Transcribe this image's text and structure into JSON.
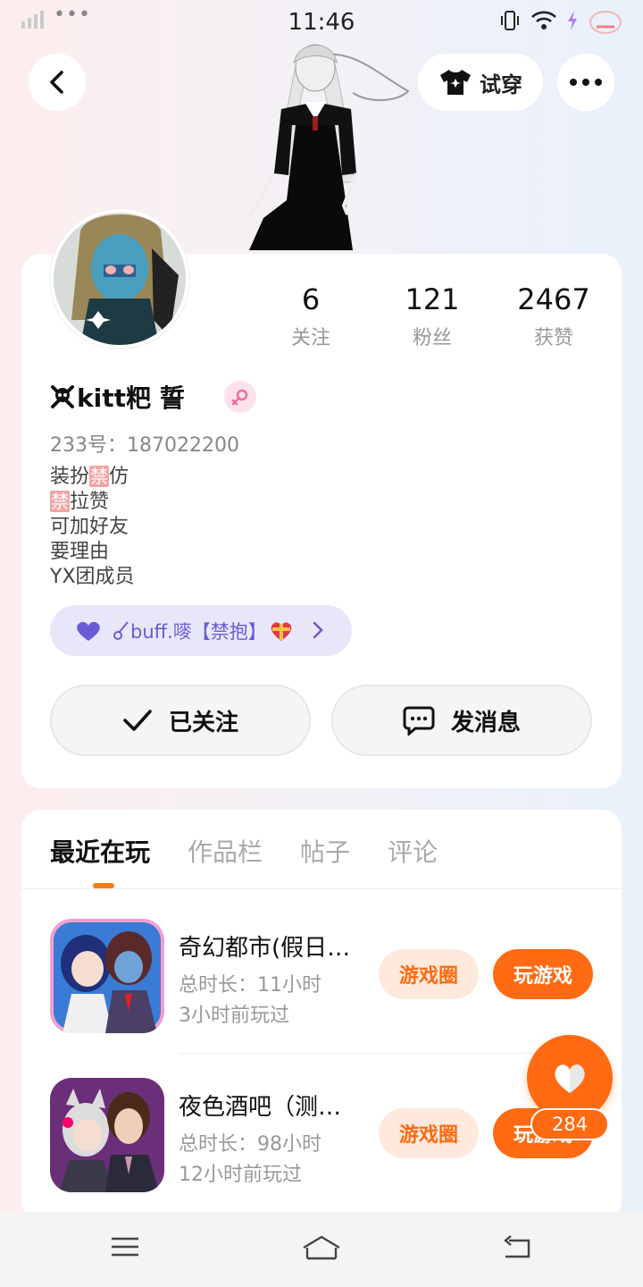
{
  "status_bar": {
    "time": "11:46",
    "dots": "•••"
  },
  "header": {
    "try_on_label": "试穿"
  },
  "stats": [
    {
      "value": "6",
      "label": "关注"
    },
    {
      "value": "121",
      "label": "粉丝"
    },
    {
      "value": "2467",
      "label": "获赞"
    }
  ],
  "profile": {
    "name": "kitt粑 誓",
    "uid": "233号：187022200",
    "bio": {
      "line1_pre": "装扮",
      "line1_ban": "禁",
      "line1_post": "仿",
      "line2_ban": "禁",
      "line2_post": "拉赞",
      "line3": "可加好友",
      "line4": "要理由",
      "line5": "YX团成员"
    },
    "buff_label": "buff.嘜【禁抱】"
  },
  "actions": {
    "follow_label": "已关注",
    "message_label": "发消息"
  },
  "tabs": [
    "最近在玩",
    "作品栏",
    "帖子",
    "评论"
  ],
  "games": [
    {
      "title": "奇幻都市(假日…",
      "duration": "总时长：11小时",
      "last_played": "3小时前玩过",
      "circle_label": "游戏圈",
      "play_label": "玩游戏"
    },
    {
      "title": "夜色酒吧（测…",
      "duration": "总时长：98小时",
      "last_played": "12小时前玩过",
      "circle_label": "游戏圈",
      "play_label": "玩游戏"
    }
  ],
  "fab": {
    "count": "284"
  },
  "colors": {
    "accent": "#ff6a12",
    "purple": "#6a5bd6"
  },
  "icons": [
    "back-icon",
    "tshirt-icon",
    "more-icon",
    "female-icon",
    "heart-icon",
    "check-icon",
    "chat-icon",
    "menu-icon",
    "home-icon",
    "return-icon",
    "skull-icon"
  ]
}
